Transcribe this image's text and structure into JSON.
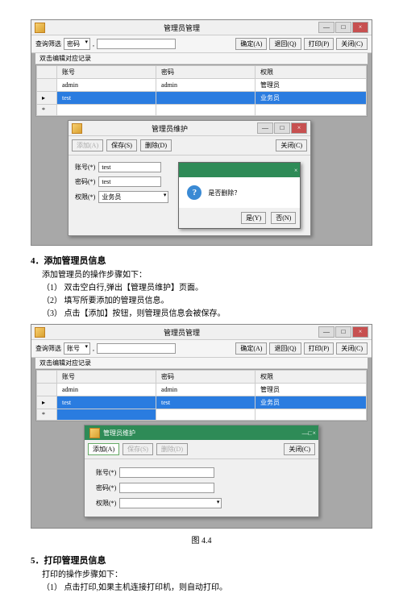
{
  "fig1": {
    "title": "管理员管理",
    "filter_label": "查询筛选",
    "filter_select": "密码",
    "btns": {
      "confirm": "确定(A)",
      "undo": "退回(Q)",
      "print": "打印(P)",
      "close": "关闭(C)"
    },
    "grid_hint": "双击编辑对应记录",
    "cols": [
      "账号",
      "密码",
      "权限"
    ],
    "rows": [
      {
        "acct": "admin",
        "pwd": "admin",
        "role": "管理员"
      },
      {
        "acct": "test",
        "pwd": "",
        "role": "业务员",
        "sel": true
      }
    ],
    "dialog": {
      "title": "管理员维护",
      "btns": {
        "add": "添加(A)",
        "save": "保存(S)",
        "del": "删除(D)",
        "close": "关闭(C)"
      },
      "form": {
        "acct_lbl": "账号(*)",
        "pwd_lbl": "密码(*)",
        "role_lbl": "权限(*)",
        "acct": "test",
        "pwd": "test",
        "role": "业务员"
      },
      "confirm": {
        "msg": "是否删除？",
        "yes": "是(Y)",
        "no": "否(N)"
      }
    }
  },
  "sec4": {
    "heading": "4．添加管理员信息",
    "intro": "添加管理员的操作步骤如下：",
    "steps": [
      "（1） 双击空白行,弹出【管理员维护】页面。",
      "（2） 填写所要添加的管理员信息。",
      "（3） 点击【添加】按钮，则管理员信息会被保存。"
    ]
  },
  "fig2": {
    "title": "管理员管理",
    "filter_label": "查询筛选",
    "filter_select": "账号",
    "grid_hint": "双击编辑对应记录",
    "cols": [
      "账号",
      "密码",
      "权限"
    ],
    "rows": [
      {
        "acct": "admin",
        "pwd": "admin",
        "role": "管理员"
      },
      {
        "acct": "test",
        "pwd": "test",
        "role": "业务员",
        "sel": true
      }
    ],
    "dialog": {
      "title": "管理员维护",
      "btns": {
        "add": "添加(A)",
        "save": "保存(S)",
        "del": "删除(D)",
        "close": "关闭(C)"
      },
      "form": {
        "acct_lbl": "账号(*)",
        "pwd_lbl": "密码(*)",
        "role_lbl": "权限(*)",
        "acct": "",
        "pwd": "",
        "role": ""
      }
    },
    "caption": "图 4.4"
  },
  "sec5": {
    "heading": "5．打印管理员信息",
    "intro": "打印的操作步骤如下：",
    "steps": [
      "（1） 点击打印,如果主机连接打印机，则自动打印。"
    ]
  }
}
